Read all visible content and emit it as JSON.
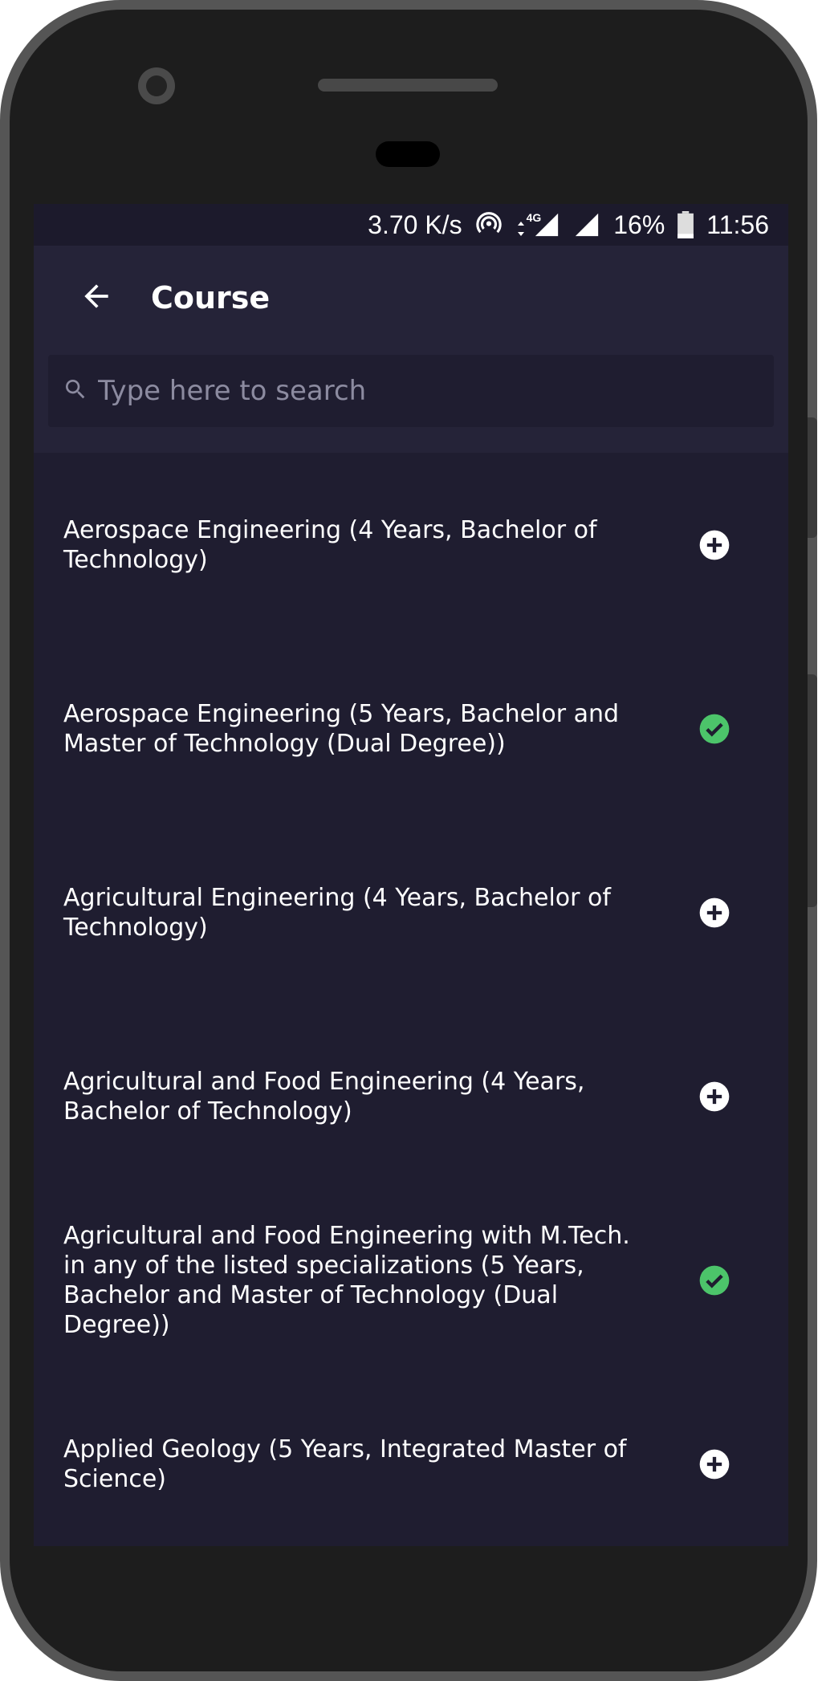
{
  "status_bar": {
    "speed": "3.70 K/s",
    "network": "4G",
    "battery": "16%",
    "time": "11:56"
  },
  "app_bar": {
    "title": "Course",
    "back_icon": "arrow-back-icon"
  },
  "search": {
    "placeholder": "Type here to search",
    "icon": "search-icon"
  },
  "colors": {
    "background": "#1f1d30",
    "app_bar": "#252338",
    "selected": "#4cc46a",
    "add": "#ffffff"
  },
  "courses": [
    {
      "name": "Aerospace Engineering (4 Years, Bachelor of Technology)",
      "selected": false
    },
    {
      "name": "Aerospace Engineering (5 Years, Bachelor and Master of Technology (Dual Degree))",
      "selected": true
    },
    {
      "name": "Agricultural Engineering (4 Years, Bachelor of Technology)",
      "selected": false
    },
    {
      "name": "Agricultural and Food Engineering (4 Years, Bachelor of Technology)",
      "selected": false
    },
    {
      "name": "Agricultural and Food Engineering with M.Tech. in any of the listed specializations (5 Years, Bachelor and Master of Technology (Dual Degree))",
      "selected": true
    },
    {
      "name": "Applied Geology (5 Years, Integrated Master of Science)",
      "selected": false
    }
  ]
}
